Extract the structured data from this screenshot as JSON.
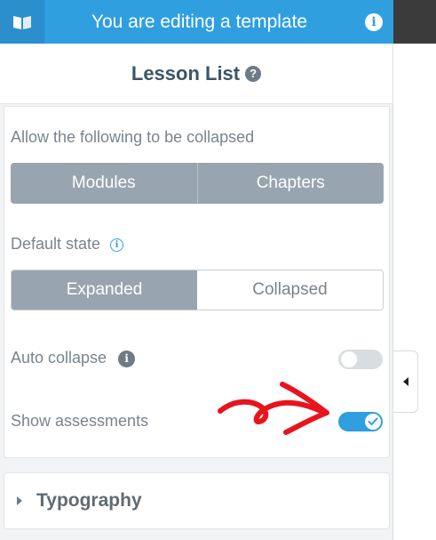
{
  "topbar": {
    "title": "You are editing a template",
    "info_icon": "i"
  },
  "panel": {
    "header_title": "Lesson List",
    "help_icon": "?"
  },
  "collapse": {
    "label": "Allow the following to be collapsed",
    "options": [
      "Modules",
      "Chapters"
    ]
  },
  "default_state": {
    "label": "Default state",
    "info": "i",
    "options": [
      "Expanded",
      "Collapsed"
    ],
    "selected": "Expanded"
  },
  "auto_collapse": {
    "label": "Auto collapse",
    "info": "i",
    "enabled": false
  },
  "show_assessments": {
    "label": "Show assessments",
    "enabled": true
  },
  "typography": {
    "label": "Typography"
  },
  "colors": {
    "accent": "#2f9fe0",
    "segment": "#98a5b0",
    "annotation": "#e8141c"
  }
}
